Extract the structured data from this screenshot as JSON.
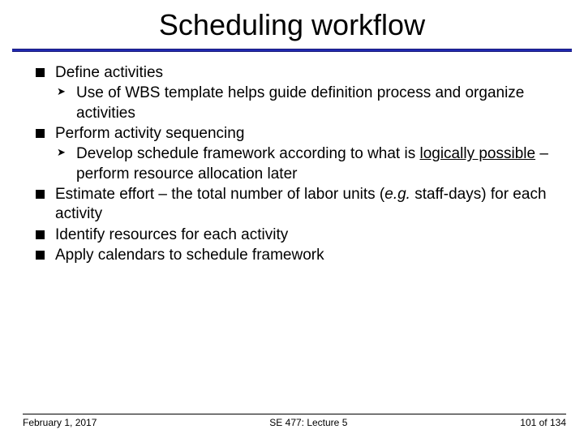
{
  "title": "Scheduling workflow",
  "bullets": {
    "b1": "Define activities",
    "b1a": "Use of WBS template helps guide definition process and organize activities",
    "b2": "Perform activity sequencing",
    "b2a_before": "Develop schedule framework according to what is ",
    "b2a_underlined": "logically possible",
    "b2a_after": " – perform resource allocation later",
    "b3_before": "Estimate effort – the total number of labor units (",
    "b3_italic": "e.g.",
    "b3_after": " staff-days) for each activity",
    "b4": "Identify resources for each activity",
    "b5": "Apply calendars to schedule framework"
  },
  "footer": {
    "left": "February 1, 2017",
    "center": "SE 477: Lecture 5",
    "right": "101 of 134"
  }
}
